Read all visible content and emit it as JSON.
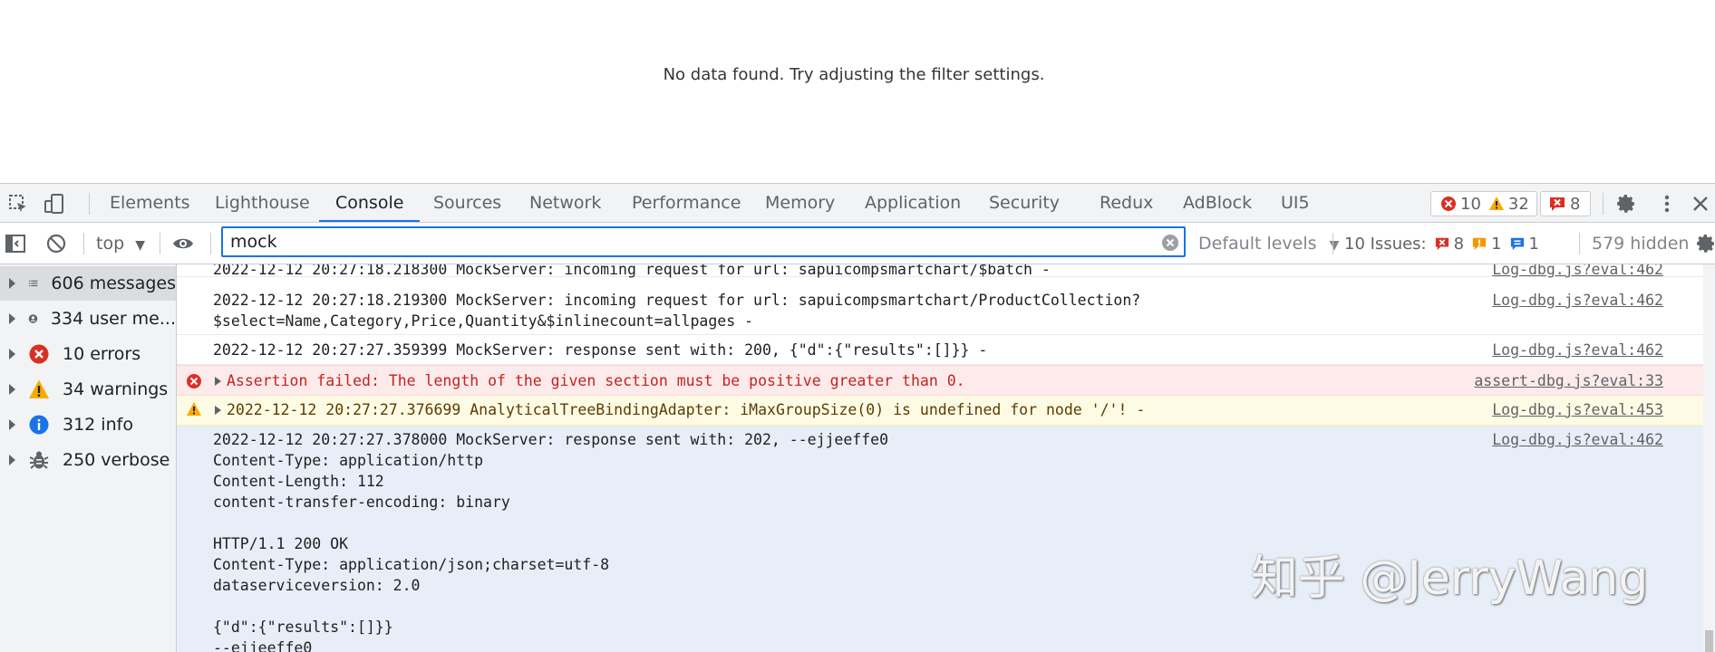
{
  "page": {
    "no_data": "No data found. Try adjusting the filter settings."
  },
  "devtools": {
    "tabs": [
      "Elements",
      "Lighthouse",
      "Console",
      "Sources",
      "Network",
      "Performance",
      "Memory",
      "Application",
      "Security",
      "Redux",
      "AdBlock",
      "UI5"
    ],
    "active_tab": "Console",
    "counters": {
      "errors": "10",
      "warnings": "32",
      "issues": "8"
    }
  },
  "filter": {
    "context": "top",
    "value": "mock",
    "levels": "Default levels",
    "issues_label": "10 Issues:",
    "issues_error": "8",
    "issues_warning": "1",
    "issues_info": "1",
    "hidden": "579 hidden"
  },
  "sidebar": {
    "items": [
      {
        "label": "606 messages",
        "icon": "list-icon"
      },
      {
        "label": "334 user me...",
        "icon": "user-icon"
      },
      {
        "label": "10 errors",
        "icon": "error-icon"
      },
      {
        "label": "34 warnings",
        "icon": "warning-icon"
      },
      {
        "label": "312 info",
        "icon": "info-icon"
      },
      {
        "label": "250 verbose",
        "icon": "bug-icon"
      }
    ]
  },
  "messages": [
    {
      "text": "2022-12-12 20:27:18.218300 MockServer: incoming request for url: sapuicompsmartchart/$batch -",
      "source": "Log-dbg.js?eval:462"
    },
    {
      "text": "2022-12-12 20:27:18.219300 MockServer: incoming request for url: sapuicompsmartchart/ProductCollection?\n$select=Name,Category,Price,Quantity&$inlinecount=allpages -",
      "source": "Log-dbg.js?eval:462"
    },
    {
      "text": "2022-12-12 20:27:27.359399 MockServer: response sent with: 200, {\"d\":{\"results\":[]}} -",
      "source": "Log-dbg.js?eval:462"
    },
    {
      "text": "Assertion failed: The length of the given section must be positive greater than 0.",
      "source": "assert-dbg.js?eval:33"
    },
    {
      "text": "2022-12-12 20:27:27.376699 AnalyticalTreeBindingAdapter: iMaxGroupSize(0) is undefined for node '/'! -",
      "source": "Log-dbg.js?eval:453"
    },
    {
      "text": "2022-12-12 20:27:27.378000 MockServer: response sent with: 202, --ejjeeffe0\nContent-Type: application/http\nContent-Length: 112\ncontent-transfer-encoding: binary\n\nHTTP/1.1 200 OK\nContent-Type: application/json;charset=utf-8\ndataserviceversion: 2.0\n\n{\"d\":{\"results\":[]}}\n--ejjeeffe0",
      "source": "Log-dbg.js?eval:462"
    }
  ],
  "watermark": "知乎 @JerryWang",
  "colors": {
    "accent": "#1a73e8",
    "error": "#d93025",
    "warning": "#f9ab00",
    "info": "#1a73e8"
  }
}
